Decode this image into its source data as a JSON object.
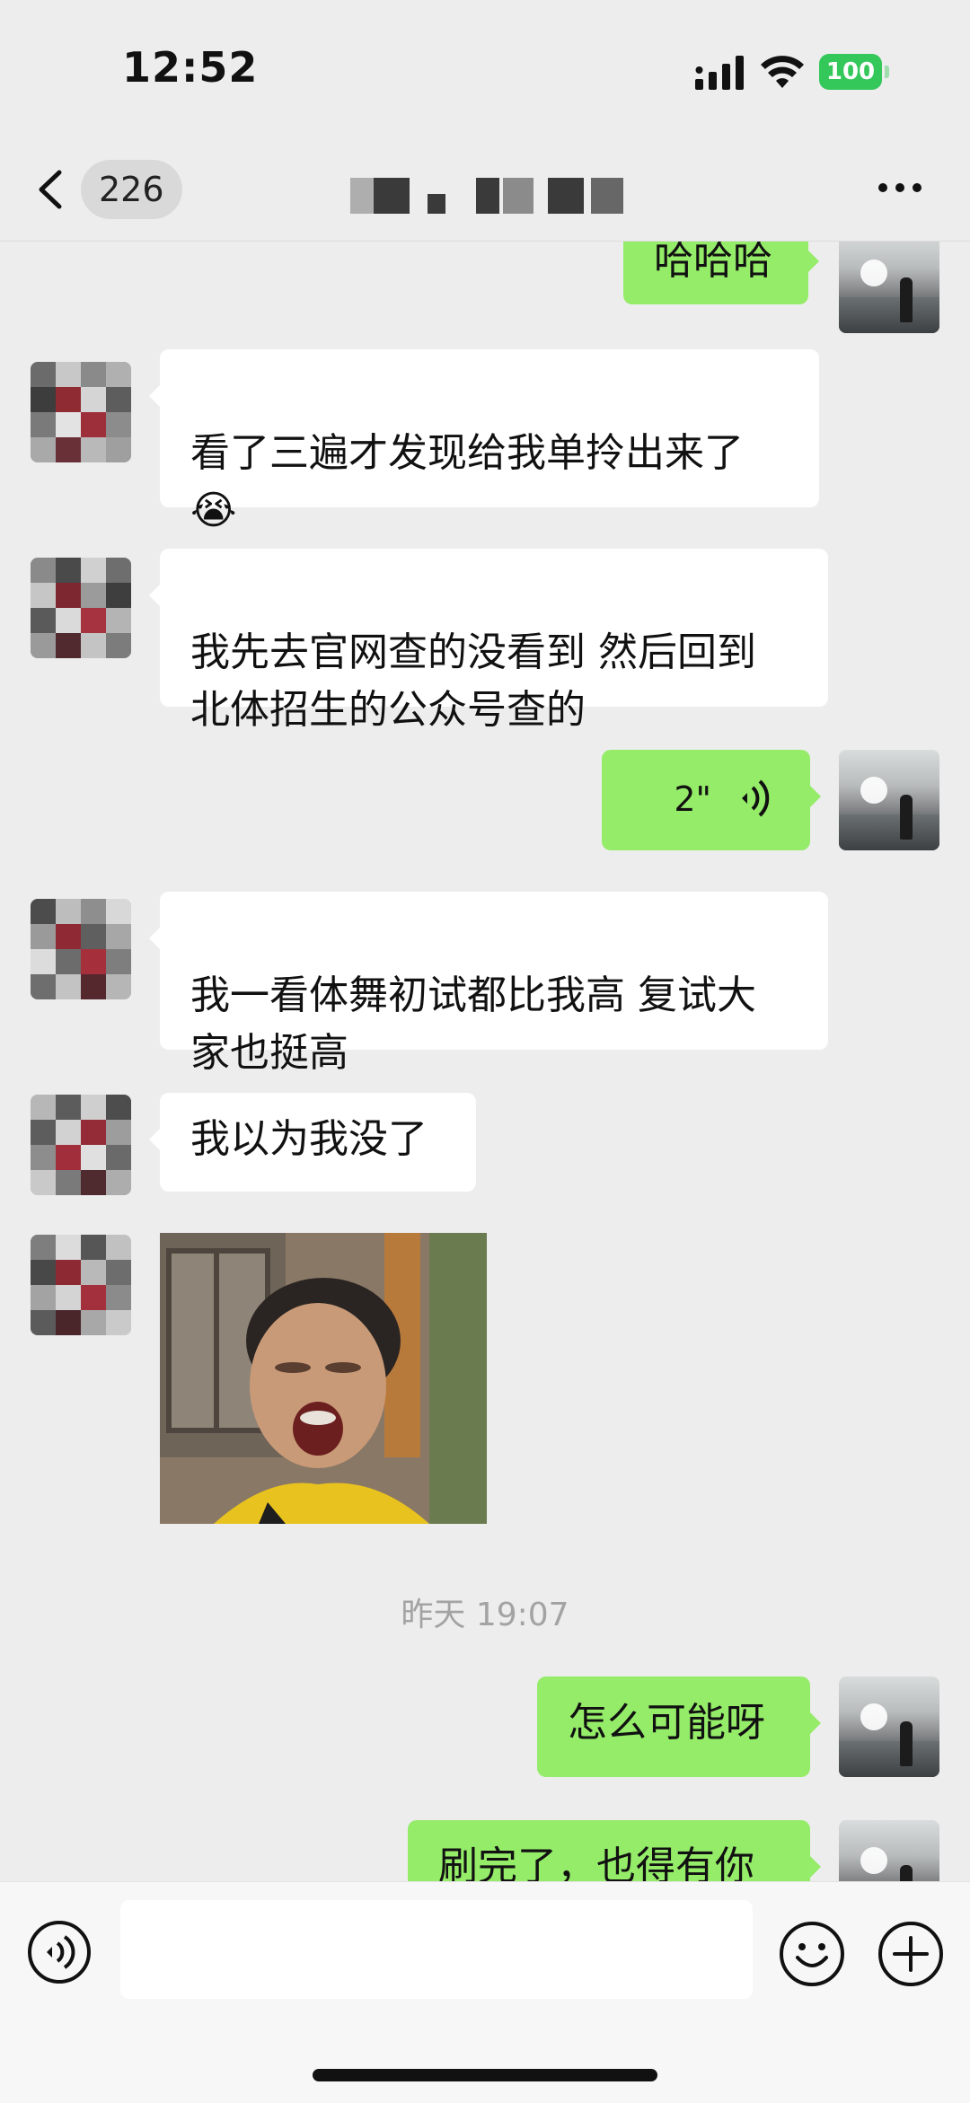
{
  "status_bar": {
    "time": "12:52",
    "battery": "100",
    "signal_icon": "signal-bars-icon",
    "wifi_icon": "wifi-icon"
  },
  "nav": {
    "unread_count": "226",
    "back_icon": "chevron-left-icon",
    "more_icon": "more-dots-icon"
  },
  "messages": [
    {
      "side": "out",
      "type": "text",
      "text": "哈哈哈"
    },
    {
      "side": "in",
      "type": "text",
      "text": "看了三遍才发现给我单拎出来了\n😭"
    },
    {
      "side": "in",
      "type": "text",
      "text": "我先去官网查的没看到 然后回到\n北体招生的公众号查的"
    },
    {
      "side": "out",
      "type": "voice",
      "duration": "2\""
    },
    {
      "side": "in",
      "type": "text",
      "text": "我一看体舞初试都比我高 复试大\n家也挺高"
    },
    {
      "side": "in",
      "type": "text",
      "text": "我以为我没了"
    },
    {
      "side": "in",
      "type": "sticker",
      "sticker": "crying-boy-sticker"
    },
    {
      "side": "out",
      "type": "text",
      "text": "怎么可能呀"
    },
    {
      "side": "out",
      "type": "text",
      "text": "刷完了，也得有你"
    }
  ],
  "timestamp": "昨天 19:07",
  "input_bar": {
    "placeholder": "",
    "voice_icon": "voice-toggle-icon",
    "emoji_icon": "emoji-icon",
    "plus_icon": "plus-icon"
  },
  "colors": {
    "bubble_out": "#95ec69",
    "bubble_in": "#ffffff",
    "background": "#ededed"
  }
}
